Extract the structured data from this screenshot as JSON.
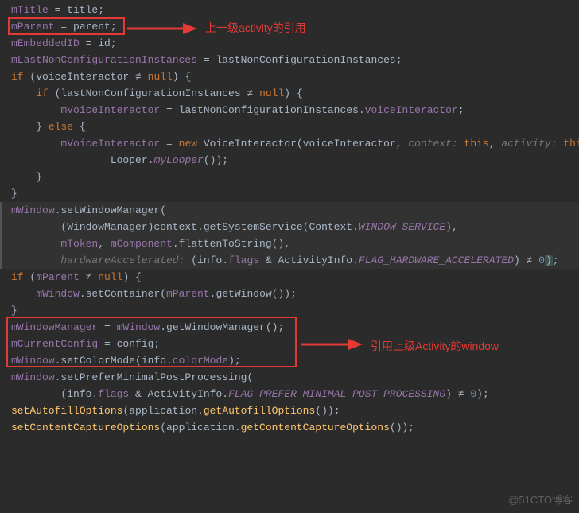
{
  "annotations": {
    "top_label": "上一级activity的引用",
    "bottom_label": "引用上级Activity的window"
  },
  "watermark": "@51CTO博客",
  "code": {
    "l01_a": "mTitle",
    "l01_b": " = title;",
    "l02_a": "mParent",
    "l02_b": " = parent;",
    "l03_a": "mEmbeddedID",
    "l03_b": " = id;",
    "l04_a": "mLastNonConfigurationInstances",
    "l04_b": " = lastNonConfigurationInstances;",
    "l05_a": "if",
    "l05_b": " (voiceInteractor ≠ ",
    "l05_c": "null",
    "l05_d": ") {",
    "l06_a": "    if",
    "l06_b": " (lastNonConfigurationInstances ≠ ",
    "l06_c": "null",
    "l06_d": ") {",
    "l07_a": "        mVoiceInteractor",
    "l07_b": " = lastNonConfigurationInstances.",
    "l07_c": "voiceInteractor",
    "l07_d": ";",
    "l08_a": "    } ",
    "l08_b": "else",
    "l08_c": " {",
    "l09_a": "        mVoiceInteractor",
    "l09_b": " = ",
    "l09_c": "new",
    "l09_d": " VoiceInteractor(voiceInteractor, ",
    "l09_e": "context:",
    "l09_f": " this",
    "l09_g": ", ",
    "l09_h": "activity:",
    "l09_i": " thi",
    "l10_a": "                Looper.",
    "l10_b": "myLooper",
    "l10_c": "());",
    "l11_a": "    }",
    "l12_a": "}",
    "l13_a": "",
    "l14_a": "mWindow",
    "l14_b": ".setWindowManager(",
    "l15_a": "        (WindowManager)context.getSystemService(Context.",
    "l15_b": "WINDOW_SERVICE",
    "l15_c": "),",
    "l16_a": "        mToken",
    "l16_b": ", ",
    "l16_c": "mComponent",
    "l16_d": ".flattenToString(),",
    "l17_a": "        ",
    "l17_b": "hardwareAccelerated:",
    "l17_c": " (info.",
    "l17_d": "flags",
    "l17_e": " & ActivityInfo.",
    "l17_f": "FLAG_HARDWARE_ACCELERATED",
    "l17_g": ") ≠ ",
    "l17_h": "0",
    "l17_i": ")",
    "l17_j": ";",
    "l18_a": "if",
    "l18_b": " (",
    "l18_c": "mParent",
    "l18_d": " ≠ ",
    "l18_e": "null",
    "l18_f": ") {",
    "l19_a": "    mWindow",
    "l19_b": ".setContainer(",
    "l19_c": "mParent",
    "l19_d": ".getWindow());",
    "l20_a": "}",
    "l21_a": "mWindowManager",
    "l21_b": " = ",
    "l21_c": "mWindow",
    "l21_d": ".getWindowManager();",
    "l22_a": "mCurrentConfig",
    "l22_b": " = config;",
    "l23_a": "",
    "l24_a": "mWindow",
    "l24_b": ".setColorMode(info.",
    "l24_c": "colorMode",
    "l24_d": ");",
    "l25_a": "mWindow",
    "l25_b": ".setPreferMinimalPostProcessing(",
    "l26_a": "        (info.",
    "l26_b": "flags",
    "l26_c": " & ActivityInfo.",
    "l26_d": "FLAG_PREFER_MINIMAL_POST_PROCESSING",
    "l26_e": ") ≠ ",
    "l26_f": "0",
    "l26_g": ");",
    "l27_a": "",
    "l28_a": "setAutofillOptions",
    "l28_b": "(application.",
    "l28_c": "getAutofillOptions",
    "l28_d": "());",
    "l29_a": "setContentCaptureOptions",
    "l29_b": "(application.",
    "l29_c": "getContentCaptureOptions",
    "l29_d": "());"
  }
}
